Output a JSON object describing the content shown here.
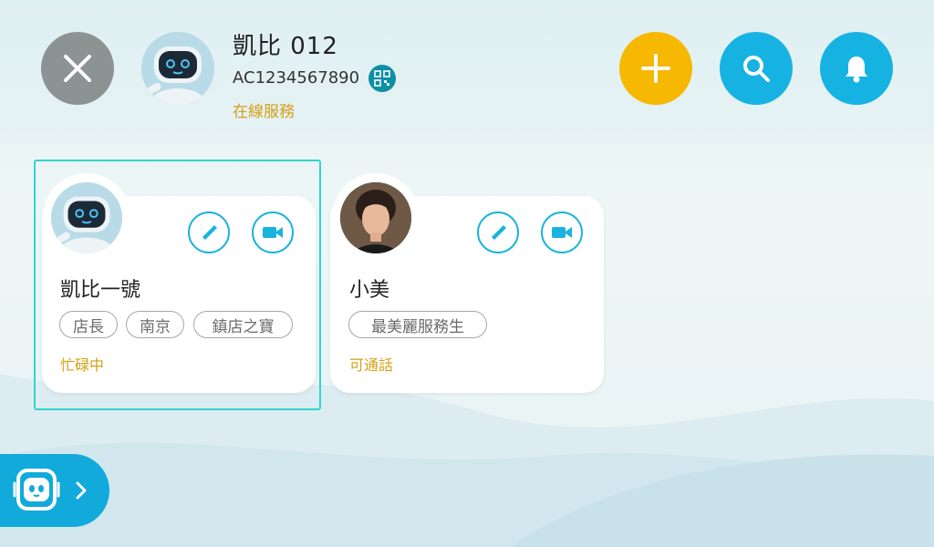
{
  "header": {
    "title": "凱比 012",
    "account_id": "AC1234567890",
    "status": "在線服務"
  },
  "contacts": [
    {
      "name": "凱比一號",
      "tags": [
        "店長",
        "南京",
        "鎮店之寶"
      ],
      "status": "忙碌中",
      "selected": true,
      "avatar": "robot-avatar"
    },
    {
      "name": "小美",
      "tags": [
        "最美麗服務生"
      ],
      "status": "可通話",
      "selected": false,
      "avatar": "person-photo-avatar"
    }
  ],
  "colors": {
    "accent": "#16b3e2",
    "add": "#f6b800",
    "close": "#8c9393",
    "status": "#d4a017",
    "highlight": "#2ed6d0"
  },
  "icons": [
    "close-icon",
    "robot-avatar",
    "qr-code-icon",
    "plus-icon",
    "search-icon",
    "bell-icon",
    "phone-icon",
    "video-icon",
    "robot-face-icon",
    "chevron-right-icon"
  ]
}
